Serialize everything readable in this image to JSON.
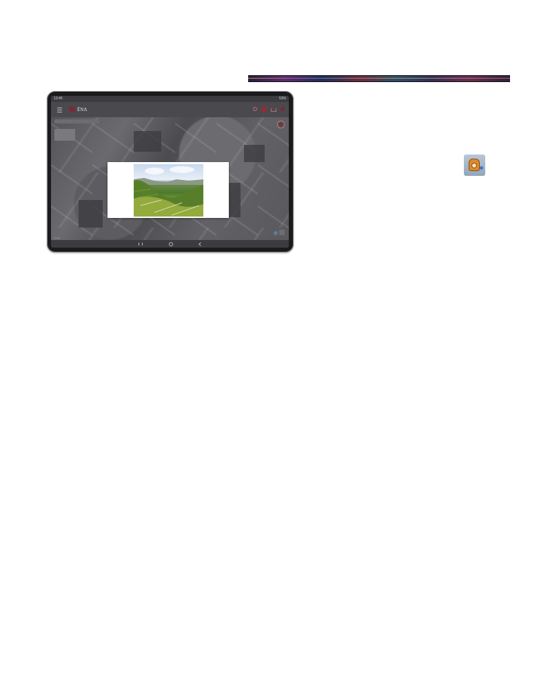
{
  "status_bar": {
    "time": "13:45",
    "battery": "53%"
  },
  "app_bar": {
    "title": "ĒNA"
  },
  "map": {
    "google_label": "Google",
    "attribution": ""
  },
  "colors": {
    "accent": "#7d2835",
    "header_bar": "#2b223d"
  },
  "icons": [
    "menu-icon",
    "app-logo-icon",
    "search-icon",
    "camera-icon",
    "share-icon",
    "account-icon",
    "locate-icon",
    "layers-icon",
    "compass-icon",
    "nav-recent-icon",
    "nav-home-icon",
    "nav-back-icon",
    "app-launcher-icon"
  ]
}
